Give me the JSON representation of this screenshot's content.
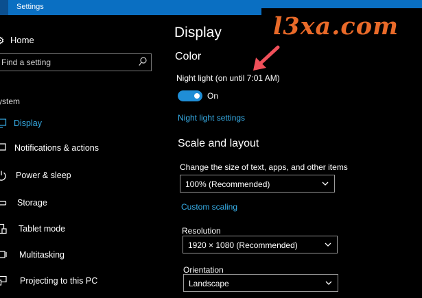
{
  "window": {
    "title": "Settings"
  },
  "sidebar": {
    "home_label": "Home",
    "search_placeholder": "Find a setting",
    "section_label": "ystem",
    "items": [
      {
        "label": "Display",
        "icon": "monitor-icon",
        "active": true
      },
      {
        "label": "Notifications & actions",
        "icon": "notifications-icon"
      },
      {
        "label": "Power & sleep",
        "icon": "power-icon"
      },
      {
        "label": "Storage",
        "icon": "storage-icon"
      },
      {
        "label": "Tablet mode",
        "icon": "tablet-mode-icon"
      },
      {
        "label": "Multitasking",
        "icon": "multitasking-icon"
      },
      {
        "label": "Projecting to this PC",
        "icon": "projecting-icon"
      }
    ]
  },
  "main": {
    "page_title": "Display",
    "color_heading": "Color",
    "night_light_label": "Night light (on until 7:01 AM)",
    "night_light_state": "On",
    "night_light_settings_link": "Night light settings",
    "scale_heading": "Scale and layout",
    "scale_label": "Change the size of text, apps, and other items",
    "scale_value": "100% (Recommended)",
    "custom_scaling_link": "Custom scaling",
    "resolution_label": "Resolution",
    "resolution_value": "1920 × 1080 (Recommended)",
    "orientation_label": "Orientation",
    "orientation_value": "Landscape"
  },
  "watermark": {
    "text": "l3xa.com"
  },
  "colors": {
    "accent": "#37aee8",
    "toggle_on": "#1f8ed6",
    "titlebar": "#0a6fc2",
    "watermark": "#e96a29",
    "arrow": "#f0505a"
  }
}
